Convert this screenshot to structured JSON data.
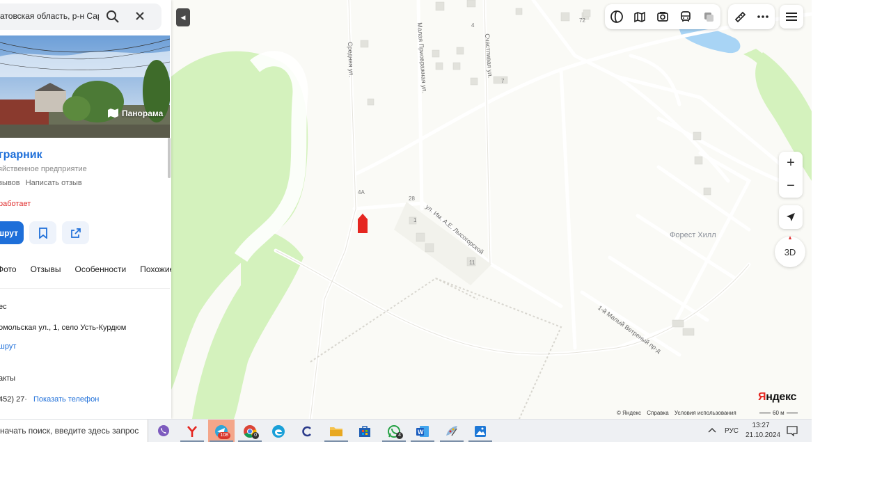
{
  "sidebar": {
    "search_value": "атовская область, р-н Сарат",
    "panorama_label": "Панорама",
    "org_name": "грарник",
    "org_category": "яйственное предприятие",
    "reviews_link": "зывов",
    "write_review": "Написать отзыв",
    "status": "работает",
    "route_btn": "шрут",
    "tabs": [
      "Фото",
      "Отзывы",
      "Особенности",
      "Похожие"
    ],
    "address_heading": "ес",
    "address_text": "омольская ул., 1, село Усть-Курдюм",
    "address_route_link": "шрут",
    "contacts_heading": "акты",
    "phone_partial": "452) 27·",
    "show_phone": "Показать телефон"
  },
  "map": {
    "streets": {
      "srednyaya": "Средняя ул.",
      "malaya": "Малая Приовражная ул.",
      "schastlivaya": "Счастливая ул.",
      "lysogorskoy": "ул. Им. А.Е. Лысогорской",
      "vetreny": "1-й Малый Ветреный пр-д"
    },
    "numbers": [
      "72",
      "4",
      "7",
      "4А",
      "28",
      "1",
      "11"
    ],
    "district": "Форест Хилл",
    "btn_3d": "3D",
    "zoom_in": "+",
    "zoom_out": "−",
    "logo_red": "Я",
    "logo_rest": "ндекс",
    "attribution": [
      "© Яндекс",
      "Справка",
      "Условия использования"
    ],
    "scale": "60 м"
  },
  "taskbar": {
    "search_placeholder": "начать поиск, введите здесь запрос",
    "yandex_badge": "108",
    "chrome_badge": "0",
    "whatsapp_badge": "4",
    "lang": "РУС",
    "time": "13:27",
    "date": "21.10.2024"
  },
  "colors": {
    "accent": "#1e6fd9",
    "water": "#a8d4f5",
    "forest": "#d4f2bd",
    "pin": "#e52620"
  }
}
